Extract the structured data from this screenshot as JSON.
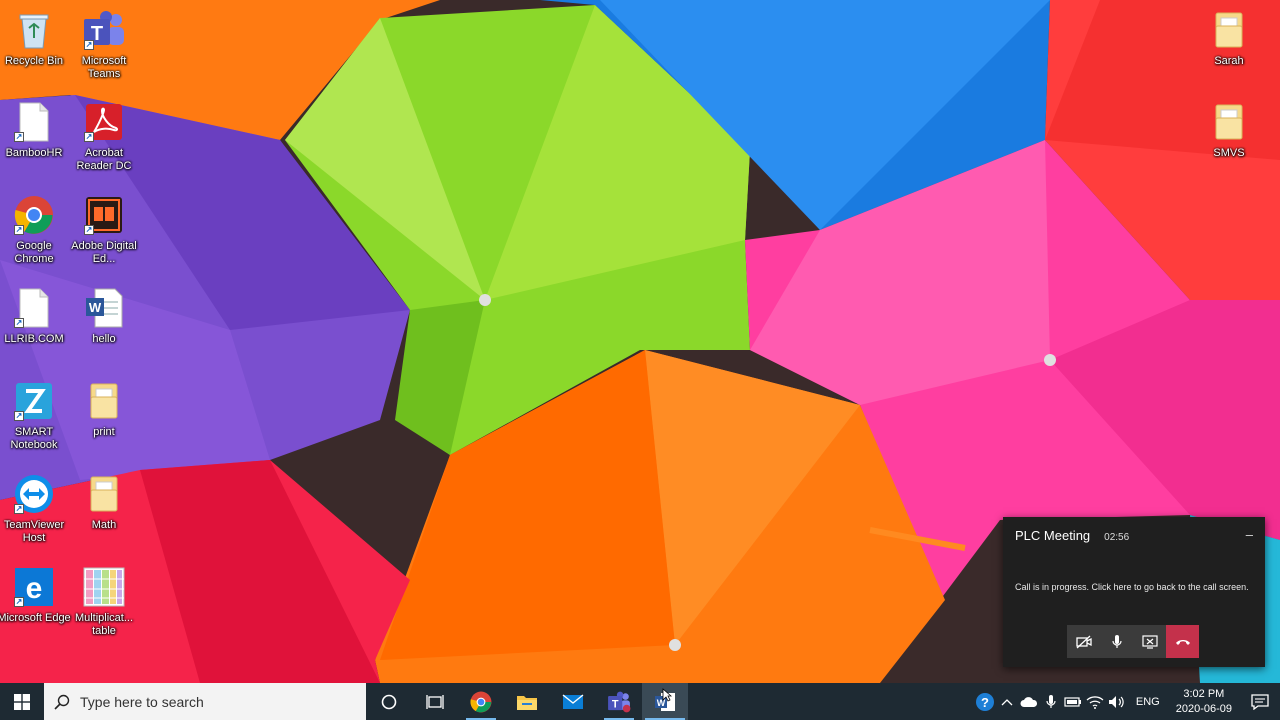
{
  "desktop": {
    "icons_left_col1": [
      {
        "name": "recycle-bin",
        "label": "Recycle Bin"
      },
      {
        "name": "bamboohr",
        "label": "BambooHR"
      },
      {
        "name": "google-chrome",
        "label": "Google Chrome"
      },
      {
        "name": "llrib",
        "label": "LLRIB.COM"
      },
      {
        "name": "smart-notebook",
        "label": "SMART Notebook"
      },
      {
        "name": "teamviewer-host",
        "label": "TeamViewer Host"
      },
      {
        "name": "microsoft-edge",
        "label": "Microsoft Edge"
      }
    ],
    "icons_left_col2": [
      {
        "name": "microsoft-teams",
        "label": "Microsoft Teams"
      },
      {
        "name": "acrobat-reader",
        "label": "Acrobat Reader DC"
      },
      {
        "name": "adobe-digital-editions",
        "label": "Adobe Digital Ed..."
      },
      {
        "name": "hello-doc",
        "label": "hello"
      },
      {
        "name": "print-folder",
        "label": "print"
      },
      {
        "name": "math-folder",
        "label": "Math"
      },
      {
        "name": "multiplication-table",
        "label": "Multiplicat... table"
      }
    ],
    "icons_right": [
      {
        "name": "sarah-folder",
        "label": "Sarah"
      },
      {
        "name": "smvs-folder",
        "label": "SMVS"
      }
    ]
  },
  "call_toast": {
    "title": "PLC Meeting",
    "timer": "02:56",
    "message": "Call is in progress. Click here to go back to the call screen.",
    "minimize": "–"
  },
  "taskbar": {
    "search_placeholder": "Type here to search",
    "language": "ENG",
    "time": "3:02 PM",
    "date": "2020-06-09"
  },
  "colors": {
    "taskbar_bg": "#1e2a33",
    "toast_bg": "#1f1f1f",
    "hangup": "#c4314b",
    "accent": "#76b9ed"
  }
}
